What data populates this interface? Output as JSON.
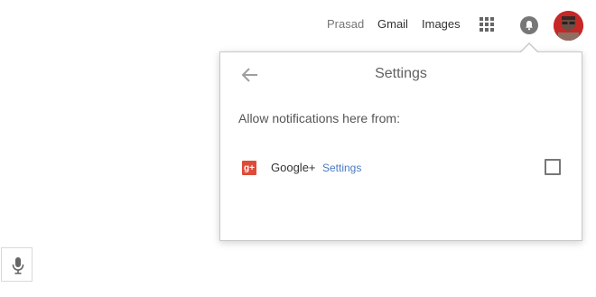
{
  "topbar": {
    "user_name": "Prasad",
    "gmail_label": "Gmail",
    "images_label": "Images",
    "apps_icon": "apps-grid-icon",
    "notifications_icon": "bell-icon",
    "avatar_icon": "user-avatar"
  },
  "settings_panel": {
    "title": "Settings",
    "back_icon": "arrow-left-icon",
    "allow_text": "Allow notifications here from:",
    "items": [
      {
        "icon": "google-plus-icon",
        "icon_text": "g+",
        "name": "Google+",
        "settings_label": "Settings",
        "checked": false
      }
    ]
  },
  "voice_search": {
    "icon": "microphone-icon"
  },
  "colors": {
    "accent_link": "#4a79c4",
    "google_plus_red": "#dd4b39",
    "bell_bg": "#777777"
  }
}
